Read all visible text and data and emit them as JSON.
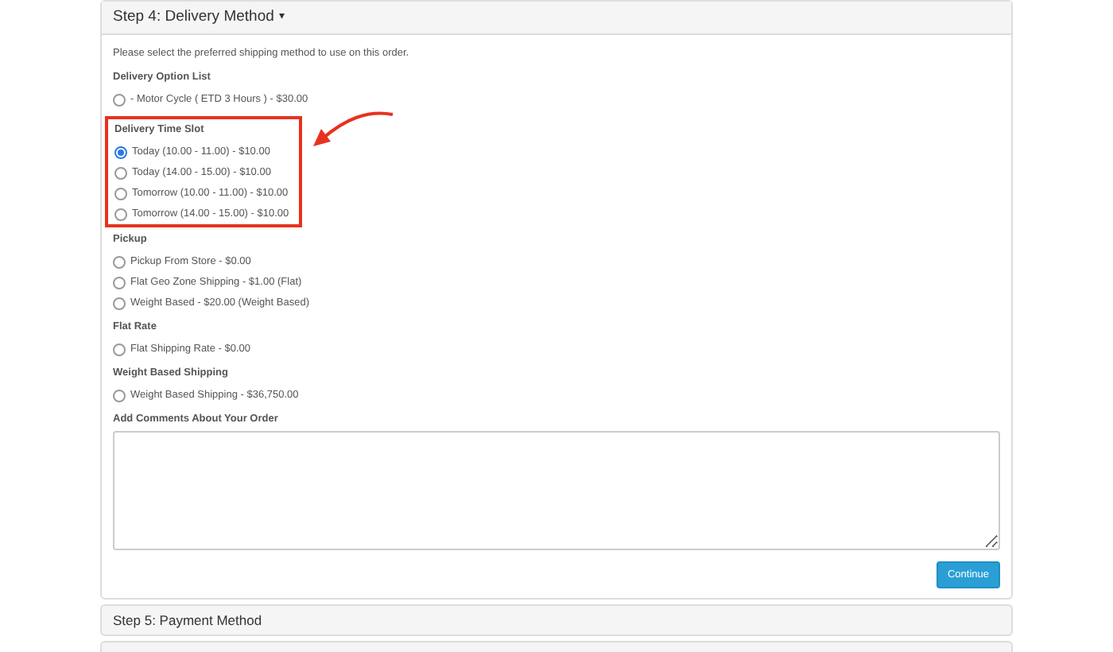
{
  "step4": {
    "title": "Step 4: Delivery Method",
    "caret": "▾",
    "intro": "Please select the preferred shipping method to use on this order.",
    "groups": [
      {
        "title": "Delivery Option List",
        "highlighted": false,
        "options": [
          {
            "label": "- Motor Cycle ( ETD 3 Hours ) - $30.00",
            "selected": false
          }
        ]
      },
      {
        "title": "Delivery Time Slot",
        "highlighted": true,
        "options": [
          {
            "label": "Today (10.00 - 11.00) - $10.00",
            "selected": true
          },
          {
            "label": "Today (14.00 - 15.00) - $10.00",
            "selected": false
          },
          {
            "label": "Tomorrow (10.00 - 11.00) - $10.00",
            "selected": false
          },
          {
            "label": "Tomorrow (14.00 - 15.00) - $10.00",
            "selected": false
          }
        ]
      },
      {
        "title": "Pickup",
        "highlighted": false,
        "options": [
          {
            "label": "Pickup From Store - $0.00",
            "selected": false
          },
          {
            "label": "Flat Geo Zone Shipping - $1.00 (Flat)",
            "selected": false
          },
          {
            "label": "Weight Based - $20.00 (Weight Based)",
            "selected": false
          }
        ]
      },
      {
        "title": "Flat Rate",
        "highlighted": false,
        "options": [
          {
            "label": "Flat Shipping Rate - $0.00",
            "selected": false
          }
        ]
      },
      {
        "title": "Weight Based Shipping",
        "highlighted": false,
        "options": [
          {
            "label": "Weight Based Shipping - $36,750.00",
            "selected": false
          }
        ]
      }
    ],
    "comments_label": "Add Comments About Your Order",
    "continue_button": "Continue"
  },
  "step5": {
    "title": "Step 5: Payment Method"
  }
}
